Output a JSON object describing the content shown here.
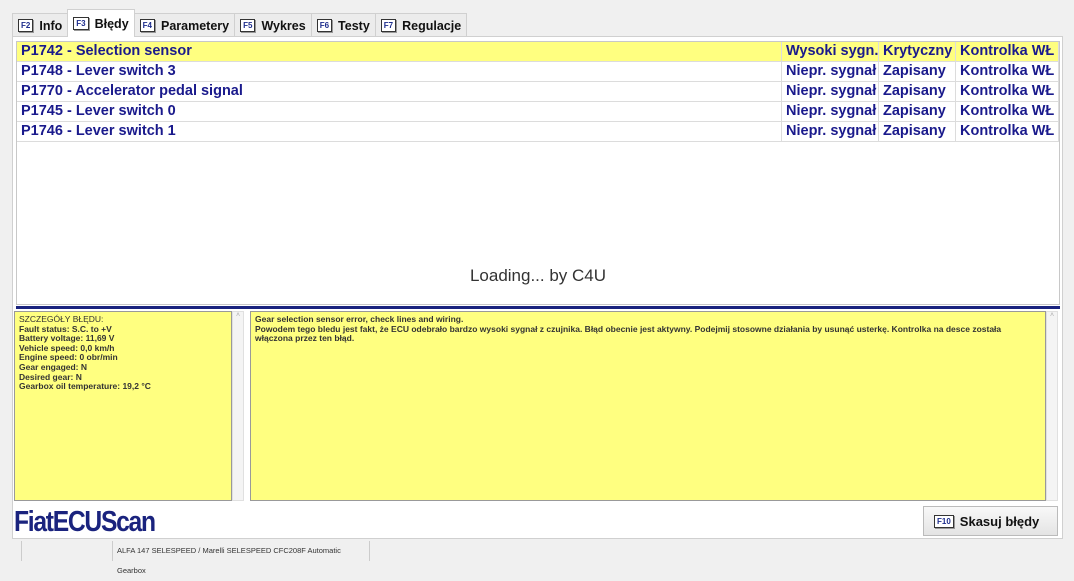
{
  "tabs": [
    {
      "key": "F2",
      "label": "Info"
    },
    {
      "key": "F3",
      "label": "Błędy"
    },
    {
      "key": "F4",
      "label": "Parametery"
    },
    {
      "key": "F5",
      "label": "Wykres"
    },
    {
      "key": "F6",
      "label": "Testy"
    },
    {
      "key": "F7",
      "label": "Regulacje"
    }
  ],
  "faults": [
    {
      "code": "P1742 - Selection sensor",
      "type": "Wysoki sygn.",
      "status": "Krytyczny",
      "lamp": "Kontrolka WŁ"
    },
    {
      "code": "P1748 - Lever switch 3",
      "type": "Niepr. sygnał",
      "status": "Zapisany",
      "lamp": "Kontrolka WŁ"
    },
    {
      "code": "P1770 - Accelerator pedal signal",
      "type": "Niepr. sygnał",
      "status": "Zapisany",
      "lamp": "Kontrolka WŁ"
    },
    {
      "code": "P1745 - Lever switch 0",
      "type": "Niepr. sygnał",
      "status": "Zapisany",
      "lamp": "Kontrolka WŁ"
    },
    {
      "code": "P1746 - Lever switch 1",
      "type": "Niepr. sygnał",
      "status": "Zapisany",
      "lamp": "Kontrolka WŁ"
    }
  ],
  "loading": "Loading... by C4U",
  "details": [
    "SZCZEGÓŁY BŁĘDU:",
    "Fault status: S.C. to +V",
    "Battery voltage: 11,69 V",
    "Vehicle speed: 0,0 km/h",
    "Engine speed: 0 obr/min",
    "Gear engaged: N",
    "Desired gear: N",
    "Gearbox oil temperature: 19,2 °C"
  ],
  "description": [
    "Gear selection sensor error, check lines and wiring.",
    "Powodem tego bledu jest fakt, że ECU odebrało bardzo wysoki sygnał z czujnika. Błąd obecnie jest aktywny. Podejmij stosowne działania by usunąć usterkę. Kontrolka na desce została włączona przez ten błąd."
  ],
  "logo": "FiatECUScan",
  "clear_button": {
    "key": "F10",
    "label": "Skasuj błędy"
  },
  "statusbar": {
    "vehicle": "ALFA 147 SELESPEED / Marelli SELESPEED CFC208F Automatic Gearbox"
  }
}
